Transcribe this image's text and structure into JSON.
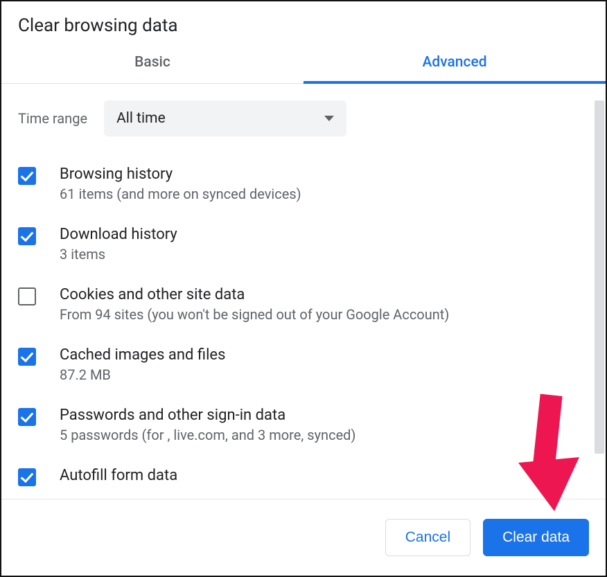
{
  "dialog": {
    "title": "Clear browsing data",
    "tabs": {
      "basic": "Basic",
      "advanced": "Advanced"
    },
    "active_tab": "advanced",
    "time_range": {
      "label": "Time range",
      "value": "All time"
    },
    "options": [
      {
        "checked": true,
        "title": "Browsing history",
        "sub": "61 items (and more on synced devices)"
      },
      {
        "checked": true,
        "title": "Download history",
        "sub": "3 items"
      },
      {
        "checked": false,
        "title": "Cookies and other site data",
        "sub": "From 94 sites (you won't be signed out of your Google Account)"
      },
      {
        "checked": true,
        "title": "Cached images and files",
        "sub": "87.2 MB"
      },
      {
        "checked": true,
        "title": "Passwords and other sign-in data",
        "sub": "5 passwords (for , live.com, and 3 more, synced)"
      },
      {
        "checked": true,
        "title": "Autofill form data",
        "sub": ""
      }
    ],
    "buttons": {
      "cancel": "Cancel",
      "clear": "Clear data"
    }
  },
  "annotation": {
    "arrow_color": "#ed1651"
  }
}
